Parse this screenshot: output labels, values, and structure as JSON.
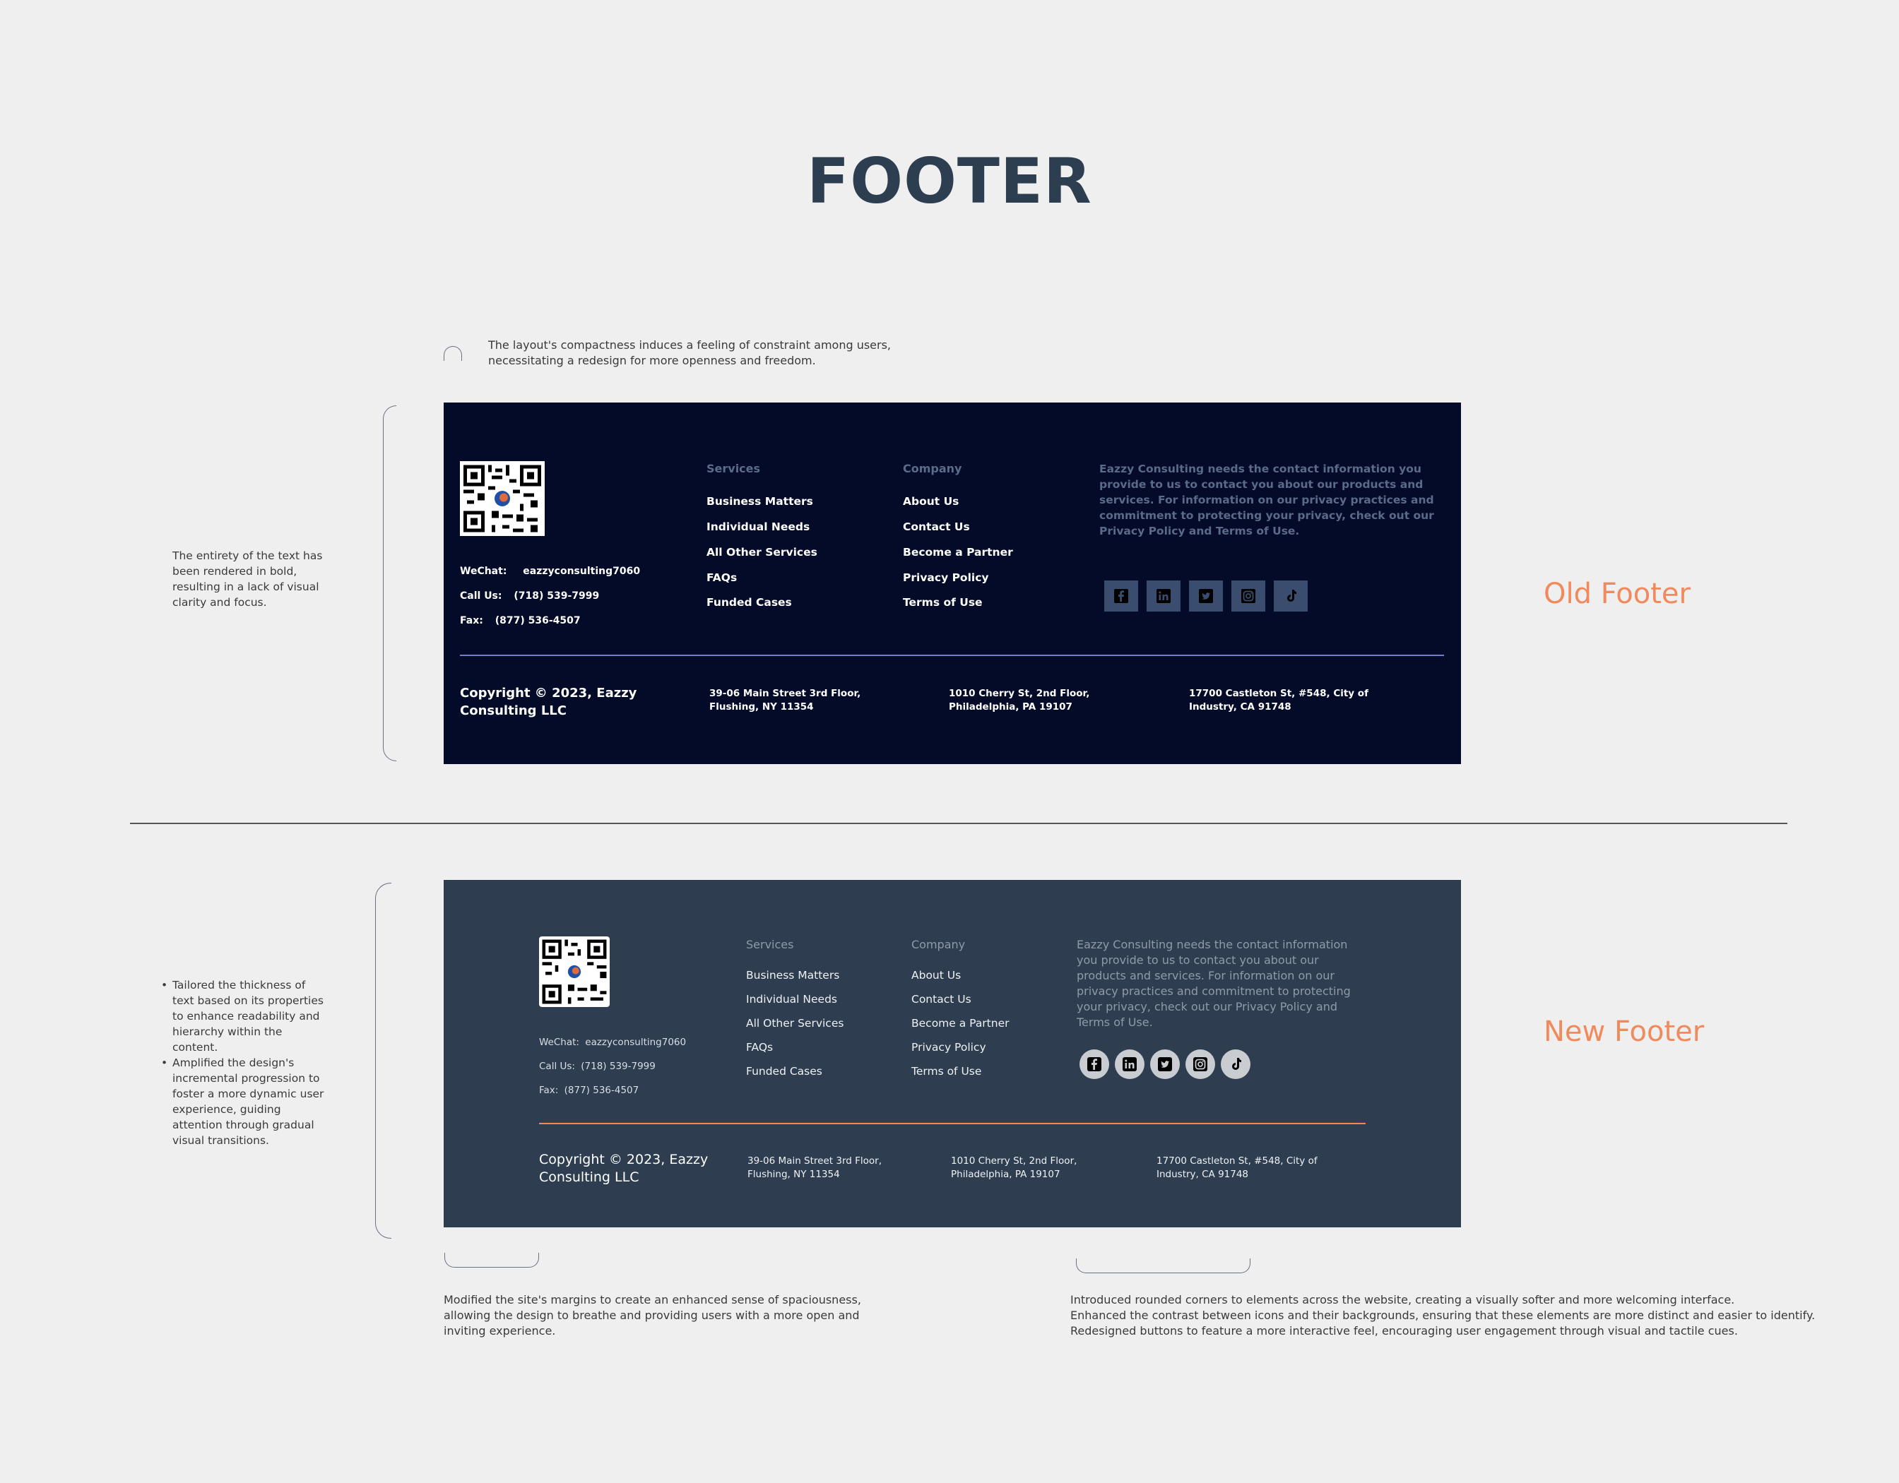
{
  "page": {
    "title": "FOOTER",
    "notes": {
      "compactness": [
        "The layout's compactness induces a feeling of constraint among users,",
        "necessitating a redesign for more openness and freedom."
      ],
      "bold_text": [
        "The entirety of the text has",
        "been rendered in bold,",
        "resulting in a lack of visual",
        "clarity and focus."
      ],
      "bullets": [
        [
          "Tailored the thickness of",
          "text based on its properties",
          "to enhance readability and",
          "hierarchy within the",
          "content."
        ],
        [
          "Amplified the design's",
          "incremental progression to",
          "foster a more dynamic user",
          "experience, guiding",
          "attention through gradual",
          "visual transitions."
        ]
      ],
      "margins": [
        "Modified the site's margins to create an enhanced sense of spaciousness,",
        "allowing the design to breathe and providing users with a more open and",
        "inviting experience."
      ],
      "corners": [
        "Introduced rounded corners to elements across the website, creating a visually softer and more welcoming interface.",
        "Enhanced the contrast between icons and their backgrounds, ensuring that these elements are more distinct and easier to identify.",
        "Redesigned buttons to feature a more interactive feel, encouraging user engagement through visual and tactile cues."
      ]
    },
    "old_label": "Old Footer",
    "new_label": "New Footer"
  },
  "footer": {
    "contact": {
      "wechat_label": "WeChat:",
      "wechat_value": "eazzyconsulting7060",
      "call_label": "Call Us:",
      "call_value": "(718) 539-7999",
      "fax_label": "Fax:",
      "fax_value": "(877) 536-4507"
    },
    "services_heading": "Services",
    "services": [
      "Business Matters",
      "Individual Needs",
      "All Other Services",
      "FAQs",
      "Funded Cases"
    ],
    "company_heading": "Company",
    "company": [
      "About Us",
      "Contact Us",
      "Become a Partner",
      "Privacy Policy",
      "Terms of Use"
    ],
    "privacy_old": [
      "Eazzy Consulting needs the contact information you",
      "provide to us to contact you about our products and",
      "services. For information on our privacy practices and",
      "commitment to protecting your privacy, check out our",
      "Privacy Policy and Terms of Use."
    ],
    "privacy_new": [
      "Eazzy Consulting needs the contact information",
      "you provide to us to contact you about our",
      "products and services. For information on our",
      "privacy practices and commitment to protecting",
      "your privacy, check out our Privacy Policy and",
      "Terms of Use."
    ],
    "social_icons": [
      "facebook-icon",
      "linkedin-icon",
      "twitter-icon",
      "instagram-icon",
      "tiktok-icon"
    ],
    "copyright": [
      "Copyright © 2023, Eazzy",
      "Consulting LLC"
    ],
    "addresses": [
      [
        "39-06 Main Street 3rd Floor,",
        "Flushing, NY 11354"
      ],
      [
        "1010 Cherry St, 2nd Floor,",
        "Philadelphia, PA 19107"
      ],
      [
        "17700 Castleton St, #548, City of",
        "Industry, CA 91748"
      ]
    ]
  },
  "colors": {
    "background": "#efefef",
    "title": "#2c3e50",
    "old_footer_bg": "#030b29",
    "old_divider": "#6f7fd0",
    "new_footer_bg": "#2e3e50",
    "new_divider": "#f08a5d",
    "accent_label": "#f08a5d"
  }
}
